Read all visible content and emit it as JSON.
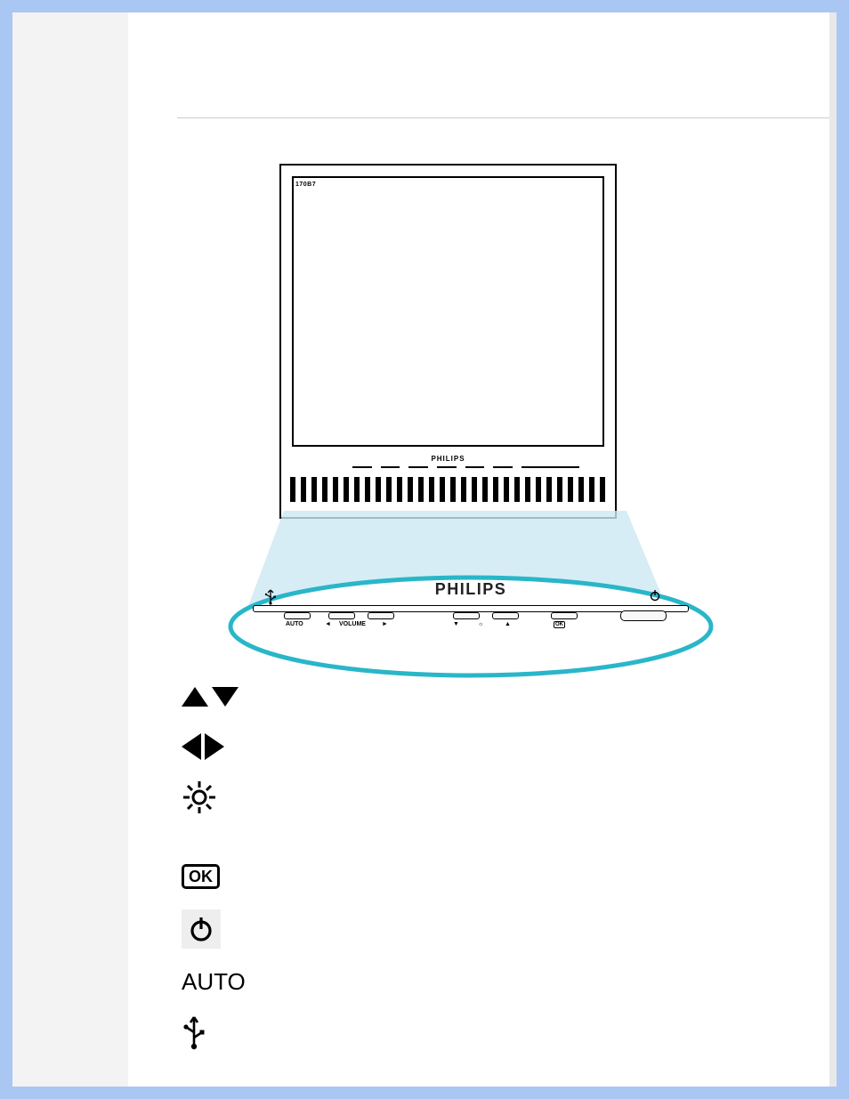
{
  "brand": "PHILIPS",
  "model": "170B7",
  "panel_labels": {
    "auto": "AUTO",
    "volume": "VOLUME",
    "volume_left": "◄",
    "volume_right": "►",
    "down": "▼",
    "brightness": "☼",
    "up": "▲",
    "ok": "OK"
  },
  "icons": {
    "up_down": {
      "name": "up-down-icon"
    },
    "left_right": {
      "name": "left-right-icon"
    },
    "brightness": {
      "name": "brightness-icon"
    },
    "ok_label": "OK",
    "power": {
      "name": "power-icon"
    },
    "auto_label": "AUTO",
    "usb": {
      "name": "usb-icon"
    }
  },
  "colors": {
    "frame": "#AAC6F3",
    "ellipse": "#29B6C9",
    "cone_fill": "#CDE8F2"
  }
}
